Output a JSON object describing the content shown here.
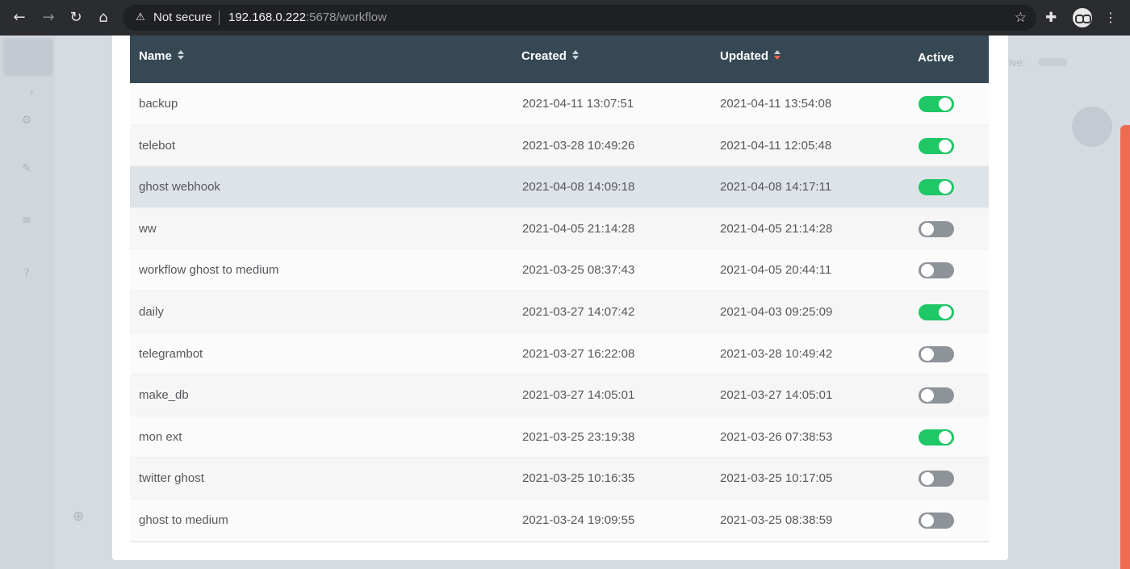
{
  "browser": {
    "back_icon": "←",
    "forward_icon": "→",
    "reload_icon": "↻",
    "home_icon": "⌂",
    "security_icon": "⚠",
    "security_label": "Not secure",
    "url_host": "192.168.0.222",
    "url_rest": ":5678/workflow",
    "bookmark_icon": "☆",
    "extensions_icon": "✚",
    "menu_icon": "⋮"
  },
  "background": {
    "sidebar_icons": [
      "›",
      "⚙",
      "✎",
      "≡",
      "?"
    ],
    "zoom_icon": "⊕",
    "right_text": "ive:"
  },
  "table": {
    "columns": [
      {
        "label": "Name",
        "sort": "none"
      },
      {
        "label": "Created",
        "sort": "none"
      },
      {
        "label": "Updated",
        "sort": "desc"
      },
      {
        "label": "Active"
      }
    ],
    "rows": [
      {
        "name": "backup",
        "created": "2021-04-11 13:07:51",
        "updated": "2021-04-11 13:54:08",
        "active": true
      },
      {
        "name": "telebot",
        "created": "2021-03-28 10:49:26",
        "updated": "2021-04-11 12:05:48",
        "active": true
      },
      {
        "name": "ghost webhook",
        "created": "2021-04-08 14:09:18",
        "updated": "2021-04-08 14:17:11",
        "active": true,
        "hover": true
      },
      {
        "name": "ww",
        "created": "2021-04-05 21:14:28",
        "updated": "2021-04-05 21:14:28",
        "active": false
      },
      {
        "name": "workflow ghost to medium",
        "created": "2021-03-25 08:37:43",
        "updated": "2021-04-05 20:44:11",
        "active": false
      },
      {
        "name": "daily",
        "created": "2021-03-27 14:07:42",
        "updated": "2021-04-03 09:25:09",
        "active": true
      },
      {
        "name": "telegrambot",
        "created": "2021-03-27 16:22:08",
        "updated": "2021-03-28 10:49:42",
        "active": false
      },
      {
        "name": "make_db",
        "created": "2021-03-27 14:05:01",
        "updated": "2021-03-27 14:05:01",
        "active": false
      },
      {
        "name": "mon ext",
        "created": "2021-03-25 23:19:38",
        "updated": "2021-03-26 07:38:53",
        "active": true
      },
      {
        "name": "twitter ghost",
        "created": "2021-03-25 10:16:35",
        "updated": "2021-03-25 10:17:05",
        "active": false
      },
      {
        "name": "ghost to medium",
        "created": "2021-03-24 19:09:55",
        "updated": "2021-03-25 08:38:59",
        "active": false
      }
    ]
  },
  "colors": {
    "header_bg": "#354854",
    "toggle_on": "#1fc766",
    "toggle_off": "#8e9399",
    "sort_active": "#ee6a52",
    "scrollbar": "#ee6a52"
  }
}
